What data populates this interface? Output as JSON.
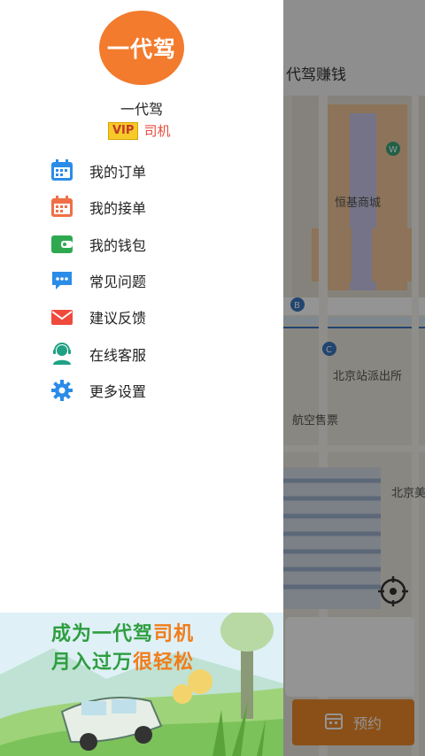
{
  "app": {
    "title": "代驾赚钱",
    "book_button_label": "预约",
    "map_labels": {
      "mall": "恒基商城",
      "police": "北京站派出所",
      "ticket": "航空售票",
      "station": "北京美"
    },
    "map_icon_letters": [
      "B",
      "C",
      "W",
      "B"
    ]
  },
  "drawer": {
    "avatar_text": "一代驾",
    "user_name": "一代驾",
    "vip_badge": "VIP",
    "role": "司机",
    "menu": [
      {
        "label": "我的订单",
        "icon": "calendar-icon",
        "color": "#2b8ce8"
      },
      {
        "label": "我的接单",
        "icon": "calendar-check-icon",
        "color": "#ef7046"
      },
      {
        "label": "我的钱包",
        "icon": "wallet-icon",
        "color": "#2fa94f"
      },
      {
        "label": "常见问题",
        "icon": "chat-bubble-icon",
        "color": "#2b8ce8"
      },
      {
        "label": "建议反馈",
        "icon": "envelope-icon",
        "color": "#ef4a3c"
      },
      {
        "label": "在线客服",
        "icon": "customer-service-icon",
        "color": "#1fa184"
      },
      {
        "label": "更多设置",
        "icon": "gear-icon",
        "color": "#2b8ce8"
      }
    ],
    "banner": {
      "line1_a": "成为一代驾",
      "line1_b": "司机",
      "line2_a": "月入过万",
      "line2_b": "很轻松"
    }
  },
  "colors": {
    "accent_orange": "#f27b2d",
    "banner_green": "#2e9e3f"
  }
}
